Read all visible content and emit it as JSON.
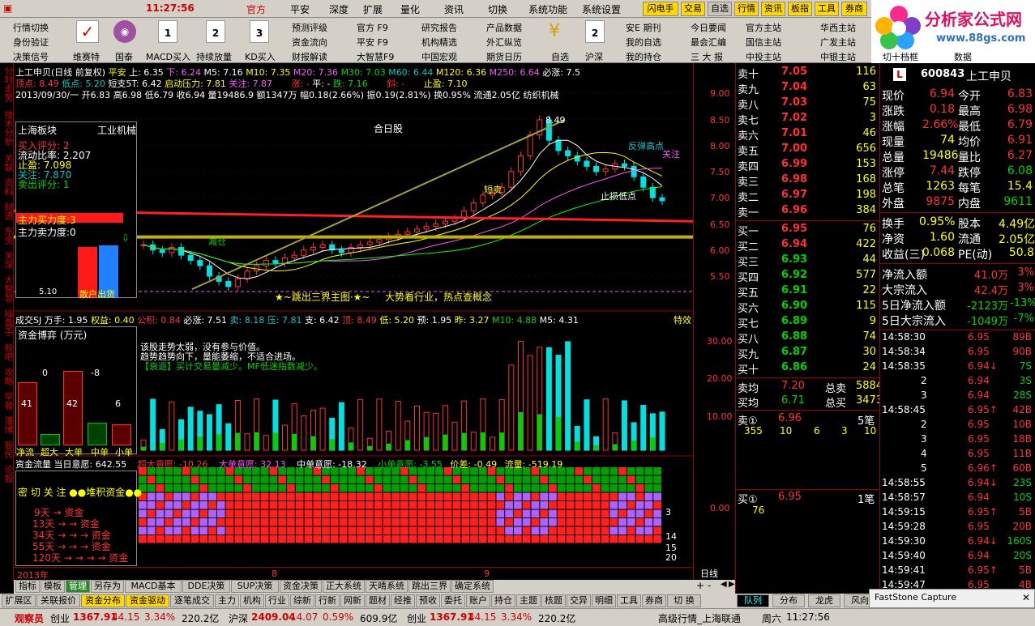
{
  "menu": {
    "time": "11:27:56",
    "items": [
      "官方",
      "平安",
      "深度",
      "扩展",
      "量化",
      "资讯",
      "切换",
      "系统功能",
      "系统设置"
    ],
    "right": [
      "闪电手",
      "交易",
      "自选",
      "行情",
      "资讯",
      "板指",
      "工具",
      "券商"
    ]
  },
  "toolbar": {
    "row1": [
      "行情切换",
      "预测评级",
      "官方",
      "F9",
      "研究报告",
      "产品数据",
      "安E 期刊",
      "今日要闻",
      "官方主站",
      "华西主站"
    ],
    "row2": [
      "身份验证",
      "资金流向",
      "平安",
      "F9",
      "机构精选",
      "外汇纵览",
      "我的自选",
      "最会汇编",
      "国信主站",
      "广发主站"
    ],
    "row3": [
      "决策信号",
      "维赛特",
      "国泰",
      "MACD买入",
      "持续放量",
      "KD买入",
      "财报解读",
      "大智慧F9",
      "中国宏观",
      "期货日历",
      "自选",
      "沪深",
      "我的持仓",
      "三 大 报",
      "中投主站",
      "中银主站",
      "切十档框",
      "数据"
    ],
    "cal": [
      "1",
      "2",
      "3",
      "2"
    ]
  },
  "logo": {
    "title": "分析家公式网",
    "url": "www.88gs.com"
  },
  "lefttabs": [
    "分时走势",
    "技术分析",
    "关联",
    "资料",
    "财透",
    "东资",
    "关深",
    "大智慧",
    "操盘手",
    "股吧",
    "攻略",
    "早餐",
    "潘博",
    "股民",
    "论股"
  ],
  "kline": {
    "header1": [
      "上工申贝(日线 前复权)",
      "平安",
      "上: 6.35",
      "下: 6.24",
      "M5: 7.16",
      "M10: 7.35",
      "M20: 7.36",
      "M30: 7.03",
      "M60: 6.44",
      "M120: 6.36",
      "M250: 6.64",
      "必涨: 7.5"
    ],
    "header2": [
      "顶点: 8.49",
      "低点: 5.20",
      "短支5T: 6.42",
      "启动压力: 7.81",
      "关注: 7.87",
      "涨: -",
      "平: -",
      "跌: 7.16",
      "斜: -",
      "止盈: 7.10"
    ],
    "header3": "2013/09/30/一  开6.83 高6.98 低6.79 收6.94 量19486.9 额1347万 幅0.18(2.66%) 振0.19(2.81%) 换0.95% 流通2.05亿 纺织机械",
    "board": [
      "上海板块",
      "工业机械"
    ],
    "panel": [
      "买入评分: 2",
      "流动比率: 2.207",
      "止盈: 7.098",
      "关注: 7.870",
      "卖出评分: 1"
    ],
    "power": [
      "主力买力度:3",
      "主力卖力度:0"
    ],
    "labels": {
      "hjx": "合日股",
      "tiao": "★~跳出三界主图·★~",
      "trend": "大势看行业，热点查概念",
      "fjl": "反弹高点",
      "gz": "关注",
      "xm": "短卖",
      "hj": "止损低点",
      "zc": "减仓",
      "low": "5.10",
      "hi": "8.49",
      "sanyin": "散户出货"
    }
  },
  "vol": {
    "header": [
      "成交SJ",
      "万手: 1.95",
      "权益: 0.40",
      "公积: 0.84",
      "必涨: 7.51",
      "卖: 8.18",
      "压: 7.81",
      "支: 6.42",
      "顶: 8.49",
      "低: 5.20",
      "预: 1.95",
      "昨: 3.27",
      "M10: 4.88",
      "M5: 4.31",
      "特效"
    ],
    "title": "资金博弈 (万元)",
    "msg": [
      "该股走势太弱，没有参与价值。",
      "趋势趋势向下，量能萎缩，不适合进场。",
      "【衰退】买计交易量减少。MF低迷指数减少。"
    ],
    "bars": [
      {
        "lab": "净流",
        "v": "41"
      },
      {
        "lab": "超大",
        "v": "0"
      },
      {
        "lab": "大单",
        "v": "42"
      },
      {
        "lab": "中单",
        "v": "-8"
      },
      {
        "lab": "小单",
        "v": "6"
      }
    ]
  },
  "fund": {
    "header": [
      "资金流量",
      "当日意愿: 642.55",
      "超大意愿: -10.26",
      "大单意愿: 32.13",
      "中单意愿: -18.32",
      "小单意愿: -3.55",
      "价差: -0.49",
      "流量: -519.19"
    ],
    "title": "密 切 关 注  ●●堆积资金●●",
    "rows": [
      "9天 → 资金",
      "13天 → → 资金",
      "34天 → → → 资金",
      "55天 → → → 资金",
      "120天 → → → → 资金"
    ],
    "rnum": [
      "3",
      "14",
      "15",
      "20"
    ]
  },
  "xaxis": {
    "year": "2013年",
    "m8": "8",
    "m9": "9",
    "mode": "日线"
  },
  "yaxis": {
    "main": [
      "9.00",
      "8.50",
      "8.00",
      "7.50",
      "7.00",
      "6.50",
      "6.00",
      "5.50"
    ],
    "vol": [
      "30.00",
      "20.00",
      "10.00"
    ],
    "fund": [
      "0.00"
    ]
  },
  "orderbook": {
    "sell": [
      [
        "卖十",
        "7.05",
        "116"
      ],
      [
        "卖九",
        "7.04",
        "63"
      ],
      [
        "卖八",
        "7.03",
        "75"
      ],
      [
        "卖七",
        "7.02",
        "3"
      ],
      [
        "卖六",
        "7.01",
        "46"
      ],
      [
        "卖五",
        "7.00",
        "656"
      ],
      [
        "卖四",
        "6.99",
        "153"
      ],
      [
        "卖三",
        "6.98",
        "168"
      ],
      [
        "卖二",
        "6.97",
        "198"
      ],
      [
        "卖一",
        "6.96",
        "384"
      ]
    ],
    "buy": [
      [
        "买一",
        "6.95",
        "76"
      ],
      [
        "买二",
        "6.94",
        "422"
      ],
      [
        "买三",
        "6.93",
        "44"
      ],
      [
        "买四",
        "6.92",
        "577"
      ],
      [
        "买五",
        "6.91",
        "22"
      ],
      [
        "买六",
        "6.90",
        "115"
      ],
      [
        "买七",
        "6.89",
        "9"
      ],
      [
        "买八",
        "6.88",
        "74"
      ],
      [
        "买九",
        "6.87",
        "30"
      ],
      [
        "买十",
        "6.86",
        "24"
      ]
    ],
    "avg": [
      [
        "卖均",
        "7.20",
        "总卖",
        "5884"
      ],
      [
        "买均",
        "6.71",
        "总买",
        "3473"
      ]
    ],
    "sell1": [
      "卖①",
      "6.96",
      "5笔"
    ],
    "sell1q": [
      "355",
      "10",
      "6",
      "3",
      "10"
    ],
    "buy1": [
      "买①",
      "6.95",
      "1笔"
    ],
    "buy1q": "76"
  },
  "info": {
    "code": "600843",
    "name": "上工申贝",
    "rows": [
      [
        "现价",
        "6.94",
        "今开",
        "6.83"
      ],
      [
        "涨跌",
        "0.18",
        "最高",
        "6.98"
      ],
      [
        "涨幅",
        "2.66%",
        "最低",
        "6.79"
      ],
      [
        "现量",
        "74",
        "均价",
        "6.91"
      ],
      [
        "总量",
        "19486",
        "量比",
        "6.27"
      ],
      [
        "涨停",
        "7.44",
        "跌停",
        "6.08"
      ],
      [
        "总笔",
        "1263",
        "每笔",
        "15.4"
      ],
      [
        "外盘",
        "9875",
        "内盘",
        "9611"
      ]
    ],
    "rows2": [
      [
        "换手",
        "0.95%",
        "股本",
        "4.49亿"
      ],
      [
        "净资",
        "1.60",
        "流通",
        "2.05亿"
      ],
      [
        "收益(三)",
        "0.068",
        "PE(动)",
        "50.8"
      ]
    ],
    "flow": [
      [
        "净流入额",
        "41.0万",
        "3%"
      ],
      [
        "大宗流入",
        "42.4万",
        "3%"
      ],
      [
        "5日净流入额",
        "-2123万",
        "-13%"
      ],
      [
        "5日大宗流入",
        "-1049万",
        "-7%"
      ]
    ],
    "ticks": [
      [
        "14:58:30",
        "6.95",
        "89B"
      ],
      [
        "14:58:34",
        "6.95",
        "90B"
      ],
      [
        "14:58:35",
        "6.94↓",
        "7S"
      ],
      [
        "2",
        "6.94",
        "3S"
      ],
      [
        "3",
        "6.94",
        "28S"
      ],
      [
        "14:58:45",
        "6.95↑",
        "42B"
      ],
      [
        "2",
        "6.95",
        "10B"
      ],
      [
        "3",
        "6.95",
        "18B"
      ],
      [
        "4",
        "6.95",
        "11B"
      ],
      [
        "5",
        "6.96↑",
        "60B"
      ],
      [
        "14:58:55",
        "6.94↓",
        "23S"
      ],
      [
        "14:58:57",
        "6.94",
        "10S"
      ],
      [
        "14:59:15",
        "6.95↑",
        "5B"
      ],
      [
        "14:59:28",
        "6.95",
        "20B"
      ],
      [
        "14:59:30",
        "6.94↓",
        "160S"
      ],
      [
        "14:59:40",
        "6.94",
        "20S"
      ],
      [
        "14:59:41",
        "6.95↑",
        "5B"
      ],
      [
        "14:59:47",
        "6.95",
        "4B"
      ]
    ]
  },
  "bottomtabs": [
    "指标",
    "模板",
    "管理",
    "另存为",
    "MACD基本",
    "DDE决策",
    "SUP决策",
    "资金决策",
    "正大系统",
    "天晴系统",
    "跳出三界",
    "确定系统"
  ],
  "statusbar": [
    "扩展区",
    "关联报价",
    "资金分布",
    "资金驱动",
    "逐笔成交",
    "主力",
    "机构",
    "行业",
    "综新",
    "行新",
    "网新",
    "题材",
    "经推",
    "预收",
    "委托",
    "账户",
    "持仓",
    "主题",
    "核题",
    "交异",
    "明细",
    "工具",
    "券商",
    "切 换"
  ],
  "rtabs": [
    "队列",
    "分布",
    "龙虎",
    "风向"
  ],
  "ticker": {
    "user": "观察员",
    "items": [
      [
        "创业",
        "1367.91",
        "44.15",
        "3.34%",
        "220.2亿"
      ],
      [
        "沪深",
        "2409.04",
        "14.07",
        "0.59%",
        "609.9亿"
      ],
      [
        "创业",
        "1367.91",
        "44.15",
        "3.34%",
        "220.2亿"
      ]
    ],
    "right": [
      "高级行情_上海联通",
      "周六",
      "11:27:56"
    ]
  },
  "fscap": "FastStone Capture"
}
